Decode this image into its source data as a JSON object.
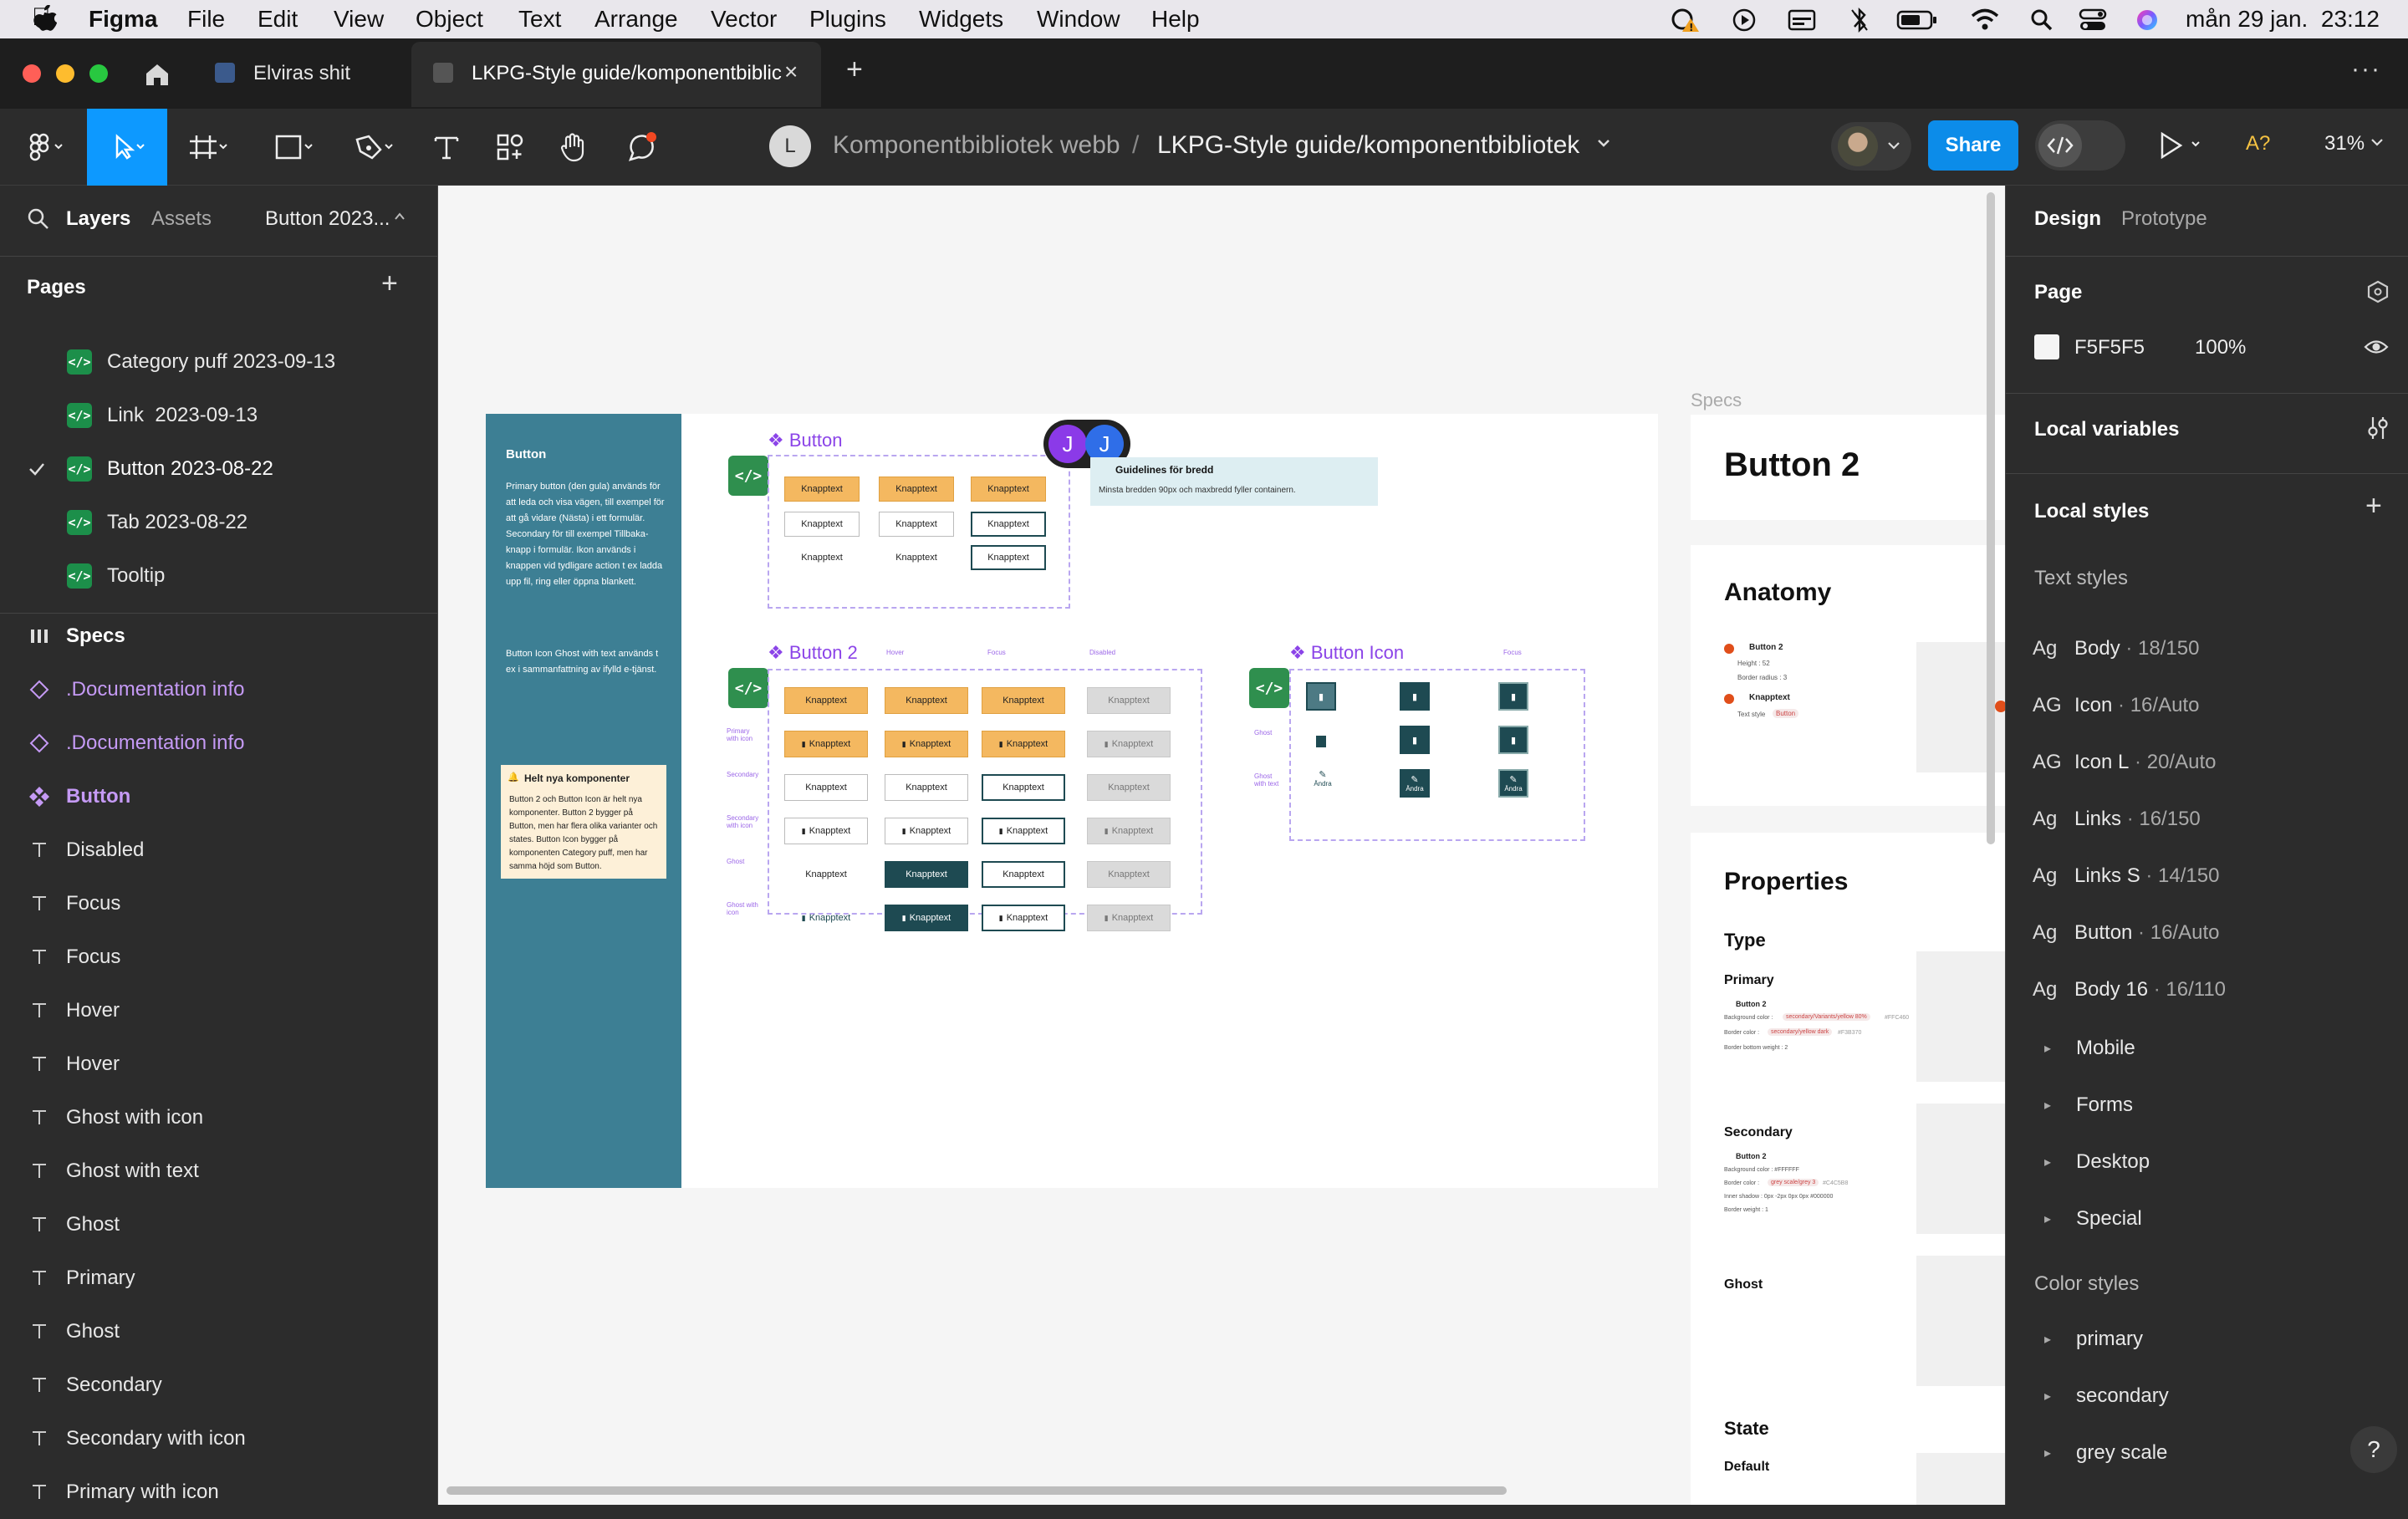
{
  "menubar": {
    "app": "Figma",
    "items": [
      "File",
      "Edit",
      "View",
      "Object",
      "Text",
      "Arrange",
      "Vector",
      "Plugins",
      "Widgets",
      "Window",
      "Help"
    ],
    "datetime": "mån 29 jan.  23:12"
  },
  "tabs": [
    {
      "label": "Elviras shit"
    },
    {
      "label": "LKPG-Style guide/komponentbiblic"
    }
  ],
  "toolbar": {
    "avatar_letter": "L",
    "breadcrumb_project": "Komponentbibliotek webb",
    "breadcrumb_separator": "/",
    "breadcrumb_file": "LKPG-Style guide/komponentbibliotek",
    "share_label": "Share",
    "font_warning": "A?",
    "zoom": "31%"
  },
  "left_panel": {
    "tab_layers": "Layers",
    "tab_assets": "Assets",
    "page_selector": "Button 2023...",
    "pages_header": "Pages",
    "pages": [
      {
        "label": "Category puff 2023-09-13",
        "current": false
      },
      {
        "label": "Link  2023-09-13",
        "current": false
      },
      {
        "label": "Button 2023-08-22",
        "current": true
      },
      {
        "label": "Tab 2023-08-22",
        "current": false
      },
      {
        "label": "Tooltip",
        "current": false
      }
    ],
    "layers": [
      {
        "label": "Specs",
        "type": "frame"
      },
      {
        "label": ".Documentation info",
        "type": "instance"
      },
      {
        "label": ".Documentation info",
        "type": "instance"
      },
      {
        "label": "Button",
        "type": "component"
      },
      {
        "label": "Disabled",
        "type": "text"
      },
      {
        "label": "Focus",
        "type": "text"
      },
      {
        "label": "Focus",
        "type": "text"
      },
      {
        "label": "Hover",
        "type": "text"
      },
      {
        "label": "Hover",
        "type": "text"
      },
      {
        "label": "Ghost with icon",
        "type": "text"
      },
      {
        "label": "Ghost with text",
        "type": "text"
      },
      {
        "label": "Ghost",
        "type": "text"
      },
      {
        "label": "Primary",
        "type": "text"
      },
      {
        "label": "Ghost",
        "type": "text"
      },
      {
        "label": "Secondary",
        "type": "text"
      },
      {
        "label": "Secondary with icon",
        "type": "text"
      },
      {
        "label": "Primary with icon",
        "type": "text"
      }
    ]
  },
  "canvas": {
    "doc_panel": {
      "title": "Button",
      "body": "Primary button (den gula) används för att leda och visa vägen, till exempel för att gå vidare (Nästa) i ett formulär. Secondary för till exempel Tillbaka-knapp i formulär. Ikon används i knappen vid tydligare action t ex ladda upp fil, ring eller öppna blankett.",
      "body2": "Button Icon Ghost with text används t ex i sammanfattning av ifylld e-tjänst.",
      "note_title": "Helt nya komponenter",
      "note_body": "Button 2 och Button Icon är helt nya komponenter. Button 2 bygger på Button, men har flera olika varianter och states. Button Icon bygger på komponenten Category puff, men har samma höjd som Button."
    },
    "button_label": "Knapptext",
    "component_button": "Button",
    "component_button2": "Button 2",
    "component_button_icon": "Button Icon",
    "guidelines_title": "Guidelines för bredd",
    "guidelines_body": "Minsta bredden 90px och maxbredd fyller containern.",
    "state_labels": [
      "Hover",
      "Focus",
      "Disabled"
    ],
    "icon_state_label": "Focus",
    "row_labels": [
      "Primary with icon",
      "Secondary",
      "Secondary with icon",
      "Ghost",
      "Ghost with icon"
    ],
    "icon_row_labels": [
      "Ghost",
      "Ghost with text"
    ],
    "icon_text": "Ändra",
    "cursor_user_a": "J",
    "cursor_user_b": "J",
    "specs_label": "Specs",
    "specs_title": "Button 2",
    "anatomy_title": "Anatomy",
    "anatomy_item1": "Button 2",
    "anatomy_item1_detail1": "Height : 52",
    "anatomy_item1_detail2": "Border radius : 3",
    "anatomy_item2": "Knapptext",
    "anatomy_item2_detail": "Text style",
    "anatomy_item2_tag": "Button",
    "properties_title": "Properties",
    "type_label": "Type",
    "primary_label": "Primary",
    "primary_comp": "Button 2",
    "primary_bg": "Background color :",
    "primary_bg_tag": "secondary/Variants/yellow 80%",
    "primary_bg_hex": "#FFC460",
    "primary_border": "Border color :",
    "primary_border_tag": "secondary/yellow dark",
    "primary_border_hex": "#F3B370",
    "primary_border_bottom": "Border bottom weight : 2",
    "secondary_label": "Secondary",
    "secondary_comp": "Button 2",
    "secondary_bg": "Background color : #FFFFFF",
    "secondary_border": "Border color :",
    "secondary_border_tag": "grey scale/grey 3",
    "secondary_border_hex": "#C4C5B8",
    "secondary_shadow": "Inner shadow : 0px -2px 0px 0px #000000",
    "secondary_weight": "Border weight : 1",
    "ghost_label": "Ghost",
    "state_title": "State",
    "default_label": "Default"
  },
  "right_panel": {
    "tab_design": "Design",
    "tab_prototype": "Prototype",
    "page_header": "Page",
    "page_color": "F5F5F5",
    "page_opacity": "100%",
    "local_variables": "Local variables",
    "local_styles": "Local styles",
    "text_styles_header": "Text styles",
    "text_styles": [
      {
        "glyph": "Ag",
        "name": "Body",
        "detail": "18/150"
      },
      {
        "glyph": "AG",
        "name": "Icon",
        "detail": "16/Auto"
      },
      {
        "glyph": "AG",
        "name": "Icon L",
        "detail": "20/Auto"
      },
      {
        "glyph": "Ag",
        "name": "Links",
        "detail": "16/150"
      },
      {
        "glyph": "Ag",
        "name": "Links S",
        "detail": "14/150"
      },
      {
        "glyph": "Ag",
        "name": "Button",
        "detail": "16/Auto"
      },
      {
        "glyph": "Ag",
        "name": "Body 16",
        "detail": "16/110"
      }
    ],
    "text_groups": [
      "Mobile",
      "Forms",
      "Desktop",
      "Special"
    ],
    "color_styles_header": "Color styles",
    "color_groups": [
      "primary",
      "secondary",
      "grey scale"
    ],
    "help": "?"
  },
  "colors": {
    "accent_blue": "#0d99ff",
    "share_blue": "#0c8ce9",
    "doc_teal": "#3d7f94",
    "figma_purple": "#9747ff",
    "page_icon_green": "#1c8f4a"
  }
}
